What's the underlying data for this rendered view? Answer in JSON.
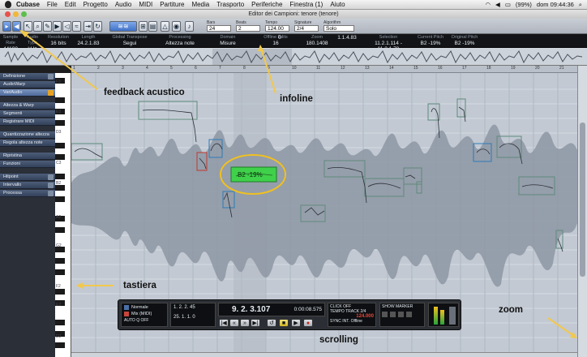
{
  "menubar": {
    "app": "Cubase",
    "items": [
      "File",
      "Edit",
      "Progetto",
      "Audio",
      "MIDI",
      "Partiture",
      "Media",
      "Trasporto",
      "Periferiche",
      "Finestra (1)",
      "Aiuto"
    ],
    "battery": "(99%)",
    "clock": "dom 09:44:36"
  },
  "window": {
    "title": "Editor dei Campioni: tenore (tenore)"
  },
  "toolbar": {
    "fields": [
      {
        "label": "Bars",
        "value": "24"
      },
      {
        "label": "Beats",
        "value": "2"
      },
      {
        "label": "Tempo",
        "value": "124.00"
      },
      {
        "label": "Signature",
        "value": "2/4"
      },
      {
        "label": "Algorithm",
        "value": "Solo"
      }
    ]
  },
  "infoline": [
    {
      "h": "Sample Rate",
      "v": "44100"
    },
    {
      "h": "Audio Type",
      "v": "kHz"
    },
    {
      "h": "Resolution",
      "v": "16 bits"
    },
    {
      "h": "Length",
      "v": "24.2.1.83"
    },
    {
      "h": "Global Transpose",
      "v": "Segui"
    },
    {
      "h": "Processing",
      "v": "Altezza note"
    },
    {
      "h": "Domain",
      "v": "Misure"
    },
    {
      "h": "Offline Edits",
      "v": "16"
    },
    {
      "h": "",
      "v": "0"
    },
    {
      "h": "Zoom",
      "v": "180.1408"
    },
    {
      "h": "",
      "v": "1.1.4.83"
    },
    {
      "h": "Selection",
      "v": "11.2.1.114 - 11.2.1.78"
    },
    {
      "h": "Current Pitch",
      "v": "B2 -19%"
    },
    {
      "h": "Original Pitch",
      "v": "B2 -19%"
    }
  ],
  "ruler": [
    "1",
    "2",
    "3",
    "4",
    "5",
    "6",
    "7",
    "8",
    "9",
    "10",
    "11",
    "12",
    "13",
    "14",
    "15",
    "16",
    "17",
    "18",
    "19",
    "20",
    "21"
  ],
  "sidebar": {
    "items": [
      {
        "label": "Definizione",
        "active": false
      },
      {
        "label": "AudioWarp",
        "active": false
      },
      {
        "label": "VariAudio",
        "active": true
      },
      {
        "label": "Altezza & Warp",
        "active": false
      },
      {
        "label": "Segmenti",
        "active": false
      },
      {
        "label": "Registrare MIDI",
        "active": false
      },
      {
        "label": "Quantizzazione altezza",
        "active": false
      },
      {
        "label": "Regola altezza note",
        "active": false
      },
      {
        "label": "Ripristina",
        "active": false
      },
      {
        "label": "Funzioni",
        "active": false
      },
      {
        "label": "Hitpoint",
        "active": false
      },
      {
        "label": "Intervallo",
        "active": false
      },
      {
        "label": "Processa",
        "active": false
      }
    ]
  },
  "keyboard": {
    "labels": [
      "F3",
      "E3",
      "D3",
      "C3",
      "B2",
      "A2",
      "G2",
      "F2",
      "E2",
      "D2"
    ]
  },
  "annotations": {
    "feedback": "feedback acustico",
    "infoline": "infoline",
    "tastiera": "tastiera",
    "scrolling": "scrolling",
    "zoom": "zoom"
  },
  "selected_segment": {
    "label": "B2 -19%"
  },
  "transport": {
    "mode_a": "Normale",
    "mode_b": "Mix (MIDI)",
    "auto_q": "AUTO Q",
    "auto_state": "OFF",
    "pos_l": "1. 2. 2. 45",
    "pos_r": "25. 1. 1. 0",
    "main_position": "9. 2. 3.107",
    "time": "0:00:08.575",
    "click": "CLICK",
    "click_state": "OFF",
    "tempo_label": "TEMPO",
    "track": "TRACK",
    "signature": "2/4",
    "tempo": "124.000",
    "sync": "SYNC",
    "sync_state": "INT.",
    "offline": "Offline",
    "show": "SHOW",
    "marker": "MARKER"
  },
  "colors": {
    "segment_border": "#5f8a7b",
    "selected_segment": "#3fd14a",
    "highlight_ellipse": "#f0c020",
    "annotation_arrow": "#f2c84b",
    "waveform": "#8d96a3"
  }
}
